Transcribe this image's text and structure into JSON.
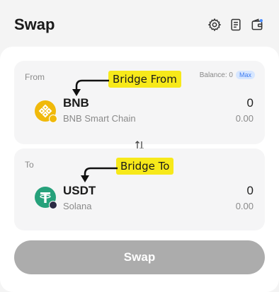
{
  "header": {
    "title": "Swap",
    "icons": [
      "gear-icon",
      "history-icon",
      "wallet-icon"
    ]
  },
  "from": {
    "label": "From",
    "balance_label": "Balance: 0",
    "max_label": "Max",
    "token_symbol": "BNB",
    "token_chain": "BNB Smart Chain",
    "amount": "0",
    "fiat": "0.00",
    "icon": "bnb-icon"
  },
  "to": {
    "label": "To",
    "token_symbol": "USDT",
    "token_chain": "Solana",
    "amount": "0",
    "fiat": "0.00",
    "icon": "usdt-icon"
  },
  "annotations": {
    "from": "Bridge From",
    "to": "Bridge To"
  },
  "swap_button": "Swap",
  "colors": {
    "bnb": "#f0b90b",
    "usdt": "#26a17b",
    "annotation": "#f7e91a",
    "button_disabled": "#acacac",
    "max_badge": "#d6e6ff"
  }
}
